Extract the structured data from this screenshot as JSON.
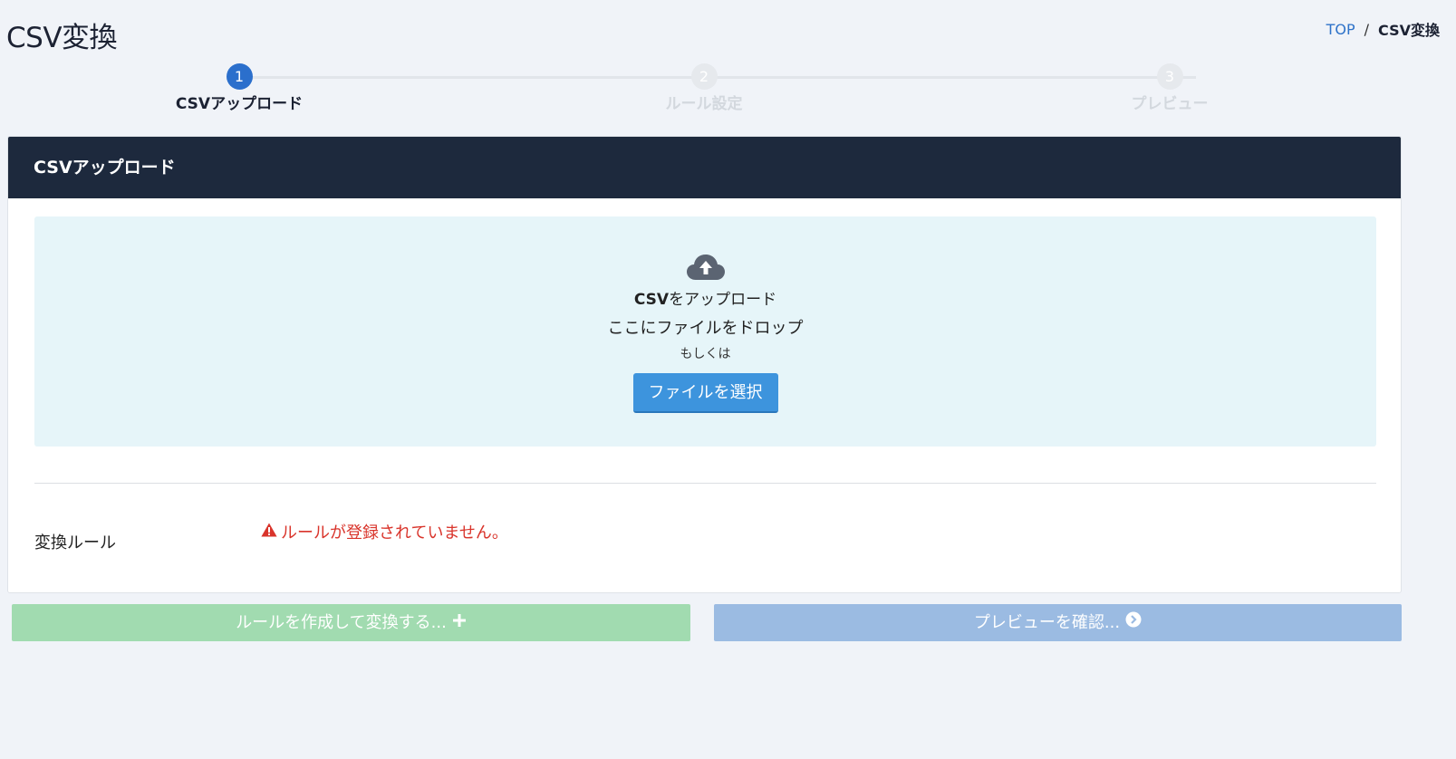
{
  "page": {
    "title": "CSV変換"
  },
  "breadcrumb": {
    "home": "TOP",
    "separator": "/",
    "current": "CSV変換"
  },
  "stepper": {
    "steps": [
      {
        "number": "1",
        "label": "CSVアップロード",
        "active": true
      },
      {
        "number": "2",
        "label": "ルール設定",
        "active": false
      },
      {
        "number": "3",
        "label": "プレビュー",
        "active": false
      }
    ]
  },
  "card": {
    "header": "CSVアップロード",
    "dropzone": {
      "icon": "cloud-upload-icon",
      "title_bold": "CSV",
      "title_rest": "をアップロード",
      "subtitle": "ここにファイルをドロップ",
      "or_text": "もしくは",
      "button_label": "ファイルを選択"
    },
    "rule": {
      "label": "変換ルール",
      "error_icon": "warning-icon",
      "error_text": "ルールが登録されていません。"
    }
  },
  "actions": {
    "create_label": "ルールを作成して変換する...",
    "create_icon": "plus-icon",
    "preview_label": "プレビューを確認...",
    "preview_icon": "chevron-right-circle-icon"
  },
  "colors": {
    "header_bg": "#1d293d",
    "active_step": "#2b6fcc",
    "dropzone_bg": "#e6f5f9",
    "primary_button": "#3d94dd",
    "error": "#d9342b",
    "create_button": "#a1dbb0",
    "preview_button": "#9bbbe2"
  }
}
